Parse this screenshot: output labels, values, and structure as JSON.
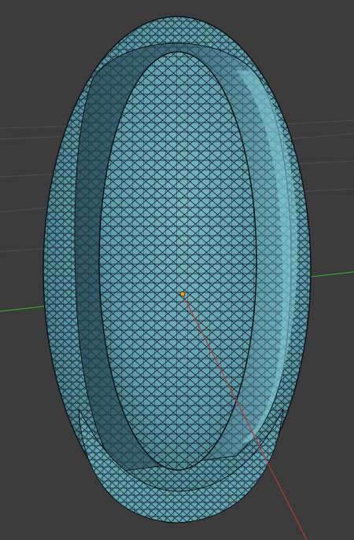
{
  "viewport": {
    "background_color": "#3b3b3b",
    "grid_color": "#555555",
    "x_axis_color": "#c0392b",
    "y_axis_color": "#2ea82e",
    "origin_color": "#f0a020"
  },
  "mesh": {
    "shape": "egg-shaped shell with inner ellipsoid",
    "surface_color": "#62a6b4",
    "surface_dark_color": "#3f7584",
    "surface_light_color": "#86c6d2",
    "wireframe_color": "#101418"
  }
}
